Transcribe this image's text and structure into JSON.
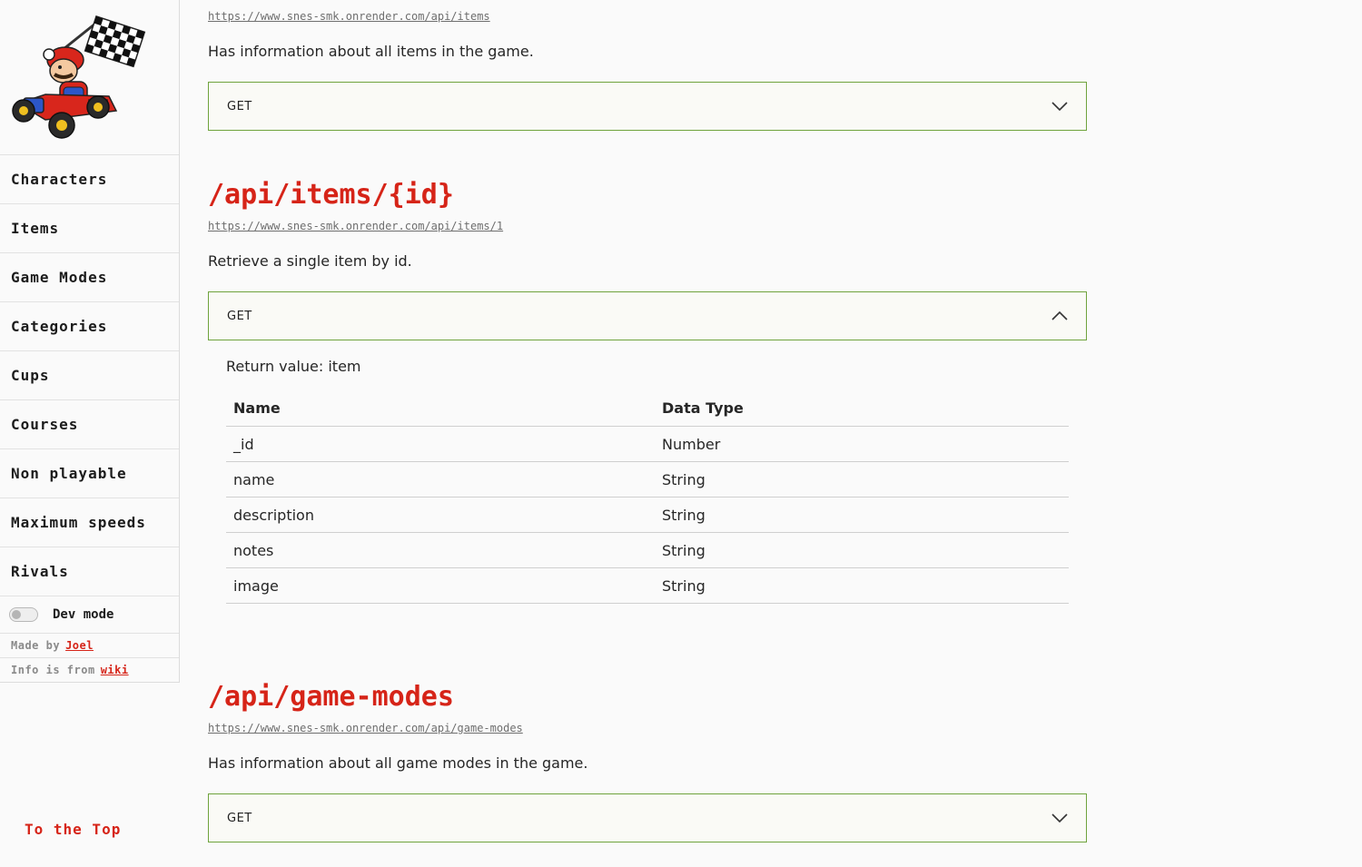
{
  "sidebar": {
    "nav": [
      "Characters",
      "Items",
      "Game Modes",
      "Categories",
      "Cups",
      "Courses",
      "Non playable",
      "Maximum speeds",
      "Rivals"
    ],
    "dev_mode_label": "Dev mode",
    "made_by_prefix": "Made by",
    "made_by_link": "Joel",
    "info_prefix": "Info is from",
    "info_link": "wiki",
    "to_top": "To the Top"
  },
  "sections": [
    {
      "url": "https://www.snes-smk.onrender.com/api/items",
      "description": "Has information about all items in the game.",
      "method": "GET",
      "expanded": false
    },
    {
      "title": "/api/items/{id}",
      "url": "https://www.snes-smk.onrender.com/api/items/1",
      "description": "Retrieve a single item by id.",
      "method": "GET",
      "expanded": true,
      "return_value": "Return value: item",
      "table": {
        "headers": [
          "Name",
          "Data Type"
        ],
        "rows": [
          [
            "_id",
            "Number"
          ],
          [
            "name",
            "String"
          ],
          [
            "description",
            "String"
          ],
          [
            "notes",
            "String"
          ],
          [
            "image",
            "String"
          ]
        ]
      }
    },
    {
      "title": "/api/game-modes",
      "url": "https://www.snes-smk.onrender.com/api/game-modes",
      "description": "Has information about all game modes in the game.",
      "method": "GET",
      "expanded": false
    }
  ],
  "colors": {
    "accent": "#d62418",
    "border_green": "#6fa33d"
  },
  "icons": {
    "collapsed": "chevron-down-icon",
    "expanded": "chevron-up-icon",
    "logo": "mario-kart-logo"
  }
}
